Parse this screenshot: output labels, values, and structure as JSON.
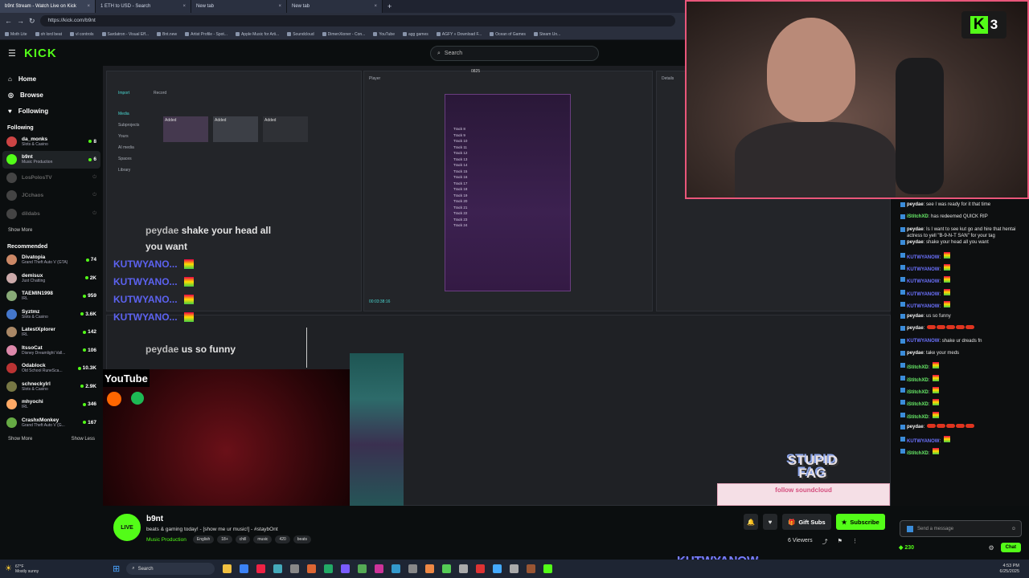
{
  "browser": {
    "tabs": [
      {
        "label": "b9nt Stream - Watch Live on Kick",
        "active": true
      },
      {
        "label": "1 ETH to USD - Search",
        "active": false
      },
      {
        "label": "New tab",
        "active": false
      },
      {
        "label": "New tab",
        "active": false
      }
    ],
    "url": "https://kick.com/b9nt",
    "bookmarks": [
      "Moth Lite",
      "oh lord beat",
      "vl controls",
      "Sardatron - Visual Eff...",
      "Bnt.new",
      "Artist Profile - Spot...",
      "Apple Music for Arti...",
      "Soundcloud",
      "DimenXioner - Con...",
      "YouTube",
      "agg games",
      "AGFY » Download F...",
      "Ocean of Games",
      "Steam Un..."
    ]
  },
  "header": {
    "logo": "KICK",
    "search_placeholder": "Search"
  },
  "sidebar": {
    "nav": [
      {
        "label": "Home",
        "icon": "home-icon"
      },
      {
        "label": "Browse",
        "icon": "compass-icon"
      },
      {
        "label": "Following",
        "icon": "heart-icon"
      }
    ],
    "following_title": "Following",
    "following": [
      {
        "name": "da_monks",
        "category": "Slots & Casino",
        "viewers": "8",
        "color": "#c44"
      },
      {
        "name": "b9nt",
        "category": "Music Production",
        "viewers": "6",
        "color": "#53fc18"
      },
      {
        "name": "LosPolosTV",
        "category": "",
        "viewers": "",
        "color": "#444"
      },
      {
        "name": "JCchaos",
        "category": "",
        "viewers": "",
        "color": "#444"
      },
      {
        "name": "dildabs",
        "category": "",
        "viewers": "",
        "color": "#444"
      }
    ],
    "show_more": "Show More",
    "recommended_title": "Recommended",
    "recommended": [
      {
        "name": "Divatopia",
        "category": "Grand Theft Auto V (GTA)",
        "viewers": "74",
        "color": "#c86"
      },
      {
        "name": "demisux",
        "category": "Just Chatting",
        "viewers": "2K",
        "color": "#caa"
      },
      {
        "name": "TAEMIN1998",
        "category": "IRL",
        "viewers": "959",
        "color": "#8a7"
      },
      {
        "name": "Syztmz",
        "category": "Slots & Casino",
        "viewers": "3.6K",
        "color": "#47c"
      },
      {
        "name": "LatestXplorer",
        "category": "IRL",
        "viewers": "142",
        "color": "#a86"
      },
      {
        "name": "ItssoCat",
        "category": "Disney Dreamlight Vall...",
        "viewers": "106",
        "color": "#d8a"
      },
      {
        "name": "Odablock",
        "category": "Old School RuneSca...",
        "viewers": "10.3K",
        "color": "#b33"
      },
      {
        "name": "schneckylrl",
        "category": "Slots & Casino",
        "viewers": "2.9K",
        "color": "#774"
      },
      {
        "name": "mhyochi",
        "category": "IRL",
        "viewers": "346",
        "color": "#fa6"
      },
      {
        "name": "CrashxMonkey",
        "category": "Grand Theft Auto V (G...",
        "viewers": "167",
        "color": "#6a4"
      }
    ],
    "show_more2": "Show More",
    "show_less": "Show Less"
  },
  "stream": {
    "editor_top": "0825",
    "player_label": "Player",
    "details_label": "Details",
    "sidebar_items": [
      "Media",
      "Subprojects",
      "Yours",
      "AI media",
      "Spaces",
      "Library"
    ],
    "import_label": "Import",
    "record_label": "Record",
    "clips": [
      "Added",
      "Added",
      "Added"
    ],
    "captions": [
      {
        "user": "peydae",
        "text": "shake your head all you want"
      },
      {
        "user": "KUTWYANO...",
        "text": ""
      },
      {
        "user": "KUTWYANO...",
        "text": ""
      },
      {
        "user": "KUTWYANO...",
        "text": ""
      },
      {
        "user": "KUTWYANO...",
        "text": ""
      },
      {
        "user": "peydae",
        "text": "us so funny"
      }
    ],
    "tracks": [
      "Track 8",
      "Track 9",
      "Track 10",
      "Track 11",
      "Track 12",
      "Track 13",
      "Track 14",
      "Track 15",
      "Track 16",
      "Track 17",
      "Track 18",
      "Track 19",
      "Track 20",
      "Track 21",
      "Track 22",
      "Track 23",
      "Track 24"
    ],
    "time": "00:03:38:16",
    "youtube_label": "YouTube",
    "overlay_text": "STUPID FAG",
    "hearts_text": "follow soundcloud"
  },
  "facecam": {
    "badge_number": "3"
  },
  "chat": {
    "messages": [
      {
        "user": "peydae",
        "text": "see I was ready for it that time",
        "cls": "u1"
      },
      {
        "user": "iStitchXD",
        "text": "has redeemed QUICK RIP",
        "cls": "u3"
      },
      {
        "user": "peydae",
        "text": "Is I want to see kut go and hire that hentai actress to yell \"B-9-N-T SAN\" for your tag",
        "cls": "u1"
      },
      {
        "user": "peydae",
        "text": "shake your head all you want",
        "cls": "u1"
      },
      {
        "user": "KUTWYANOW",
        "text": "",
        "cls": "u2"
      },
      {
        "user": "KUTWYANOW",
        "text": "",
        "cls": "u2"
      },
      {
        "user": "KUTWYANOW",
        "text": "",
        "cls": "u2"
      },
      {
        "user": "KUTWYANOW",
        "text": "",
        "cls": "u2"
      },
      {
        "user": "KUTWYANOW",
        "text": "",
        "cls": "u2"
      },
      {
        "user": "peydae",
        "text": "us so funny",
        "cls": "u1"
      },
      {
        "user": "peydae",
        "text": "",
        "cls": "u1",
        "pills": true
      },
      {
        "user": "KUTWYANOW",
        "text": "shake ur dreads fn",
        "cls": "u2"
      },
      {
        "user": "peydae",
        "text": "take your meds",
        "cls": "u1"
      },
      {
        "user": "iStitchXD",
        "text": "",
        "cls": "u3"
      },
      {
        "user": "iStitchXD",
        "text": "",
        "cls": "u3"
      },
      {
        "user": "iStitchXD",
        "text": "",
        "cls": "u3"
      },
      {
        "user": "iStitchXD",
        "text": "",
        "cls": "u3"
      },
      {
        "user": "iStitchXD",
        "text": "",
        "cls": "u3"
      },
      {
        "user": "peydae",
        "text": "",
        "cls": "u1",
        "pills": true
      },
      {
        "user": "KUTWYANOW",
        "text": "",
        "cls": "u2"
      },
      {
        "user": "iStitchXD",
        "text": "",
        "cls": "u3"
      }
    ],
    "input_placeholder": "Send a message",
    "points": "230",
    "chat_button": "Chat"
  },
  "channel": {
    "name": "b9nt",
    "title": "beats & gaming today! - [show me ur music!] - #staybOnt",
    "category": "Music Production",
    "tags": [
      "English",
      "18+",
      "chill",
      "music",
      "420",
      "beats"
    ],
    "gift_subs": "Gift Subs",
    "subscribe": "Subscribe",
    "viewers": "6 Viewers"
  },
  "overlay_name": "KUTWYANOW",
  "taskbar": {
    "temp": "67°F",
    "weather": "Mostly sunny",
    "search": "Search",
    "time": "4:53 PM",
    "date": "6/25/2025"
  },
  "colors": {
    "kick_green": "#53fc18",
    "facecam_border": "#e9567a"
  }
}
